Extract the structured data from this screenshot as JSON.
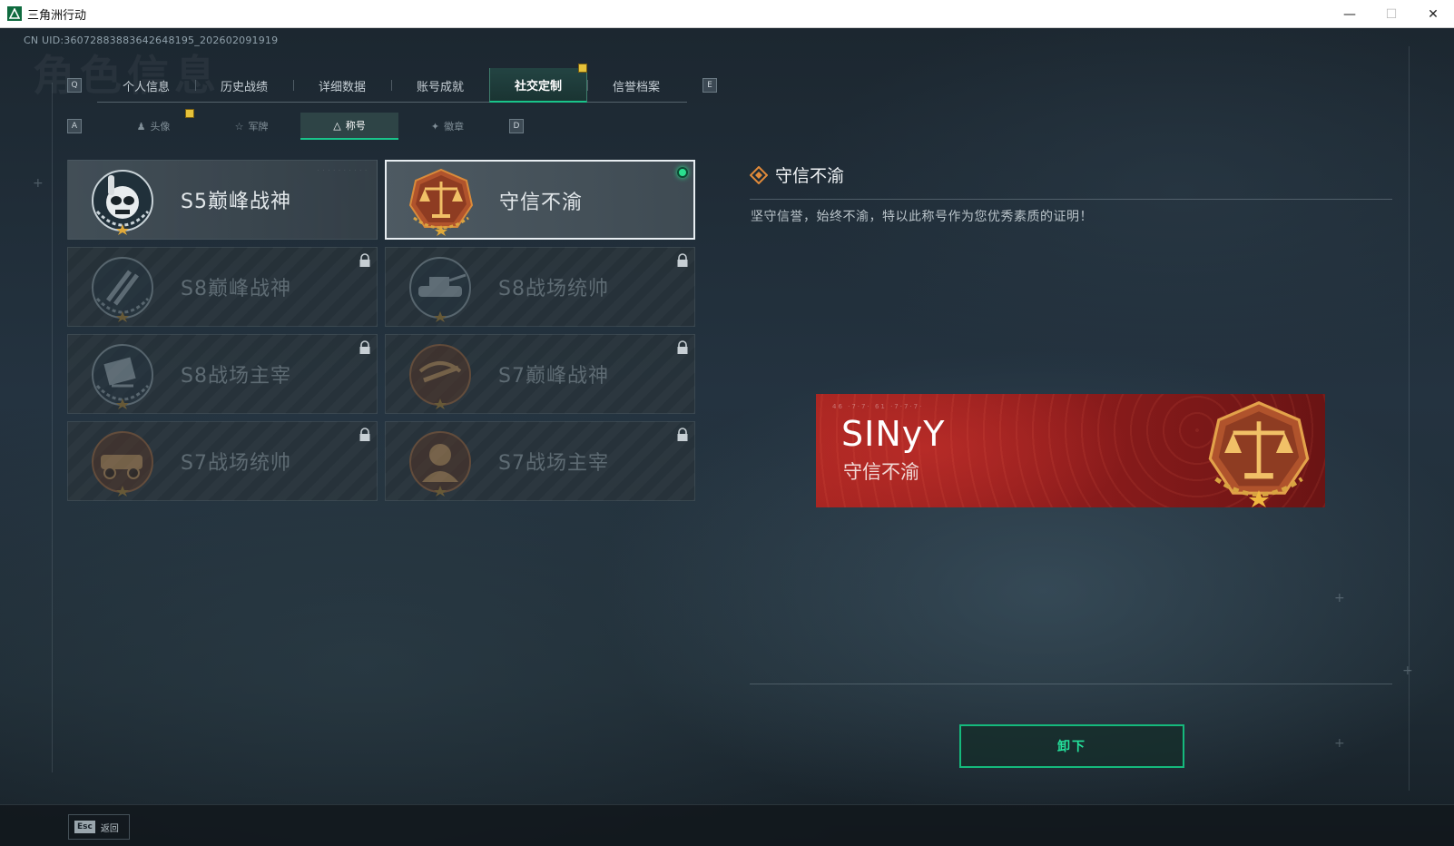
{
  "window": {
    "title": "三角洲行动",
    "minimize": "—",
    "maximize": "☐",
    "close": "✕"
  },
  "uid": "CN UID:36072883883642648195_202602091919",
  "ghost_title": "角色信息",
  "keys": {
    "prev_tab": "Q",
    "next_tab": "E",
    "prev_sub": "A",
    "next_sub": "D"
  },
  "main_tabs": [
    {
      "label": "个人信息",
      "active": false
    },
    {
      "label": "历史战绩",
      "active": false
    },
    {
      "label": "详细数据",
      "active": false
    },
    {
      "label": "账号成就",
      "active": false
    },
    {
      "label": "社交定制",
      "active": true
    },
    {
      "label": "信誉档案",
      "active": false
    }
  ],
  "sub_tabs": [
    {
      "label": "头像",
      "icon": "person-icon",
      "active": false
    },
    {
      "label": "军牌",
      "icon": "dogtag-icon",
      "active": false
    },
    {
      "label": "称号",
      "icon": "triangle-icon",
      "active": true
    },
    {
      "label": "徽章",
      "icon": "badge-icon",
      "active": false
    }
  ],
  "titles": [
    {
      "name": "S5巅峰战神",
      "state": "unlocked",
      "emblem": "diver-skull-icon"
    },
    {
      "name": "守信不渝",
      "state": "selected",
      "emblem": "scales-icon"
    },
    {
      "name": "S8巅峰战神",
      "state": "locked",
      "emblem": "stripes-icon"
    },
    {
      "name": "S8战场统帅",
      "state": "locked",
      "emblem": "tank-icon"
    },
    {
      "name": "S8战场主宰",
      "state": "locked",
      "emblem": "rocket-launcher-icon"
    },
    {
      "name": "S7巅峰战神",
      "state": "locked",
      "emblem": "crossbow-icon"
    },
    {
      "name": "S7战场统帅",
      "state": "locked",
      "emblem": "armored-car-icon"
    },
    {
      "name": "S7战场主宰",
      "state": "locked",
      "emblem": "soldier-icon"
    }
  ],
  "detail": {
    "title": "守信不渝",
    "description": "坚守信誉，始终不渝，特以此称号作为您优秀素质的证明！"
  },
  "banner": {
    "player_name": "SINyY",
    "title": "守信不渝",
    "deco": "46 ·7·7· 61 ·7·7·7·"
  },
  "unequip_button": "卸下",
  "footer": {
    "esc_key": "Esc",
    "back_label": "返回"
  },
  "colors": {
    "accent_green": "#19c48a",
    "banner_red": "#a72521",
    "badge_yellow": "#e6c23a",
    "emblem_bronze": "#c8862e"
  }
}
